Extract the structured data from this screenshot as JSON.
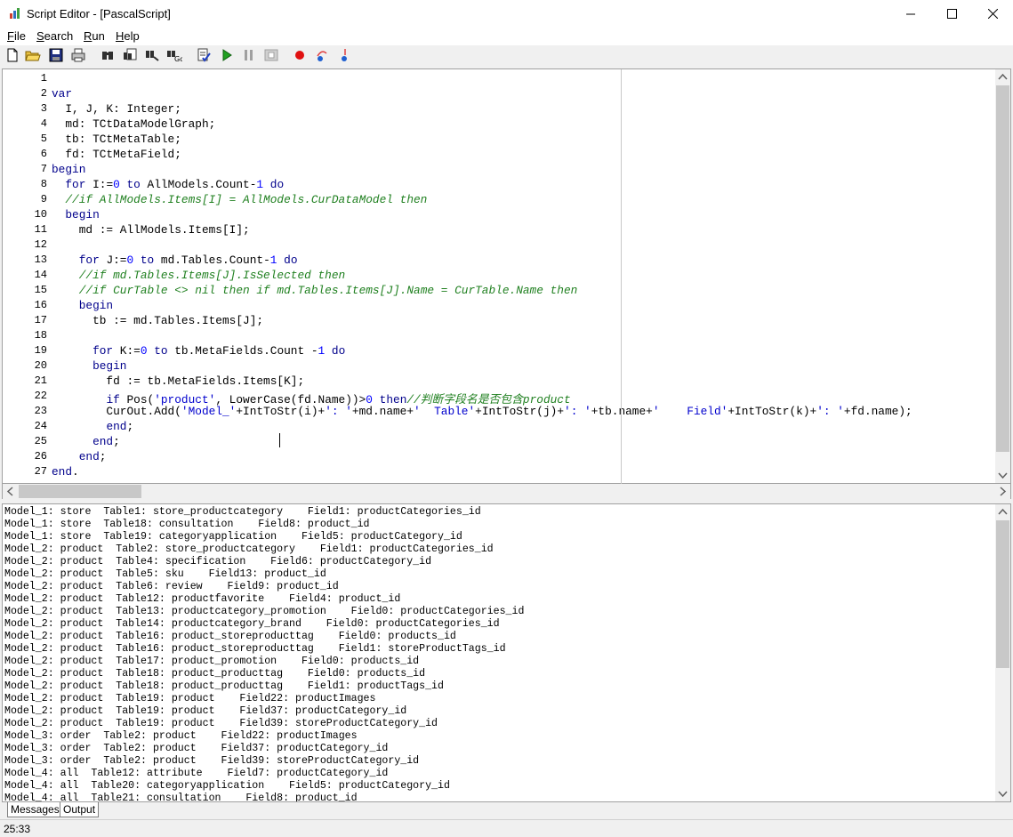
{
  "window": {
    "title": "Script Editor - [PascalScript]"
  },
  "menu": [
    {
      "label": "File",
      "accel": "F",
      "rest": "ile"
    },
    {
      "label": "Search",
      "accel": "S",
      "rest": "earch"
    },
    {
      "label": "Run",
      "accel": "R",
      "rest": "un"
    },
    {
      "label": "Help",
      "accel": "H",
      "rest": "elp"
    }
  ],
  "toolbar": [
    {
      "name": "new-file-icon"
    },
    {
      "name": "open-folder-icon"
    },
    {
      "name": "save-icon"
    },
    {
      "name": "print-icon"
    },
    {
      "name": "find-icon"
    },
    {
      "name": "find-next-icon"
    },
    {
      "name": "replace-icon"
    },
    {
      "name": "goto-line-icon"
    },
    {
      "name": "compile-icon"
    },
    {
      "name": "run-icon"
    },
    {
      "name": "pause-icon"
    },
    {
      "name": "stop-icon"
    },
    {
      "name": "breakpoint-icon"
    },
    {
      "name": "step-over-icon"
    },
    {
      "name": "step-into-icon"
    }
  ],
  "editor": {
    "lines": [
      {
        "n": "1",
        "t": ""
      },
      {
        "n": "2",
        "t": "<span class='kw'>var</span>"
      },
      {
        "n": "3",
        "t": "  I, J, K: Integer;"
      },
      {
        "n": "4",
        "t": "  md: TCtDataModelGraph;"
      },
      {
        "n": "5",
        "t": "  tb: TCtMetaTable;"
      },
      {
        "n": "6",
        "t": "  fd: TCtMetaField;"
      },
      {
        "n": "7",
        "t": "<span class='kw'>begin</span>"
      },
      {
        "n": "8",
        "t": "  <span class='kw'>for</span> I:=<span class='num'>0</span> <span class='kw'>to</span> AllModels.Count-<span class='num'>1</span> <span class='kw'>do</span>"
      },
      {
        "n": "9",
        "t": "  <span class='cm'>//if AllModels.Items[I] = AllModels.CurDataModel then</span>"
      },
      {
        "n": "10",
        "t": "  <span class='kw'>begin</span>"
      },
      {
        "n": "11",
        "t": "    md := AllModels.Items[I];"
      },
      {
        "n": "12",
        "t": ""
      },
      {
        "n": "13",
        "t": "    <span class='kw'>for</span> J:=<span class='num'>0</span> <span class='kw'>to</span> md.Tables.Count-<span class='num'>1</span> <span class='kw'>do</span>"
      },
      {
        "n": "14",
        "t": "    <span class='cm'>//if md.Tables.Items[J].IsSelected then</span>"
      },
      {
        "n": "15",
        "t": "    <span class='cm'>//if CurTable &lt;&gt; nil then if md.Tables.Items[J].Name = CurTable.Name then</span>"
      },
      {
        "n": "16",
        "t": "    <span class='kw'>begin</span>"
      },
      {
        "n": "17",
        "t": "      tb := md.Tables.Items[J];"
      },
      {
        "n": "18",
        "t": ""
      },
      {
        "n": "19",
        "t": "      <span class='kw'>for</span> K:=<span class='num'>0</span> <span class='kw'>to</span> tb.MetaFields.Count -<span class='num'>1</span> <span class='kw'>do</span>"
      },
      {
        "n": "20",
        "t": "      <span class='kw'>begin</span>"
      },
      {
        "n": "21",
        "t": "        fd := tb.MetaFields.Items[K];"
      },
      {
        "n": "22",
        "t": "        <span class='kw'>if</span> Pos(<span class='str'>'product'</span>, LowerCase(fd.Name))&gt;<span class='num'>0</span> <span class='kw'>then</span><span class='cm'>//判断字段名是否包含product</span>"
      },
      {
        "n": "23",
        "t": "        CurOut.Add(<span class='str'>'Model_'</span>+IntToStr(i)+<span class='str'>': '</span>+md.name+<span class='str'>'  Table'</span>+IntToStr(j)+<span class='str'>': '</span>+tb.name+<span class='str'>'    Field'</span>+IntToStr(k)+<span class='str'>': '</span>+fd.name);"
      },
      {
        "n": "24",
        "t": "        <span class='kw'>end</span>;"
      },
      {
        "n": "25",
        "t": "      <span class='kw'>end</span>;"
      },
      {
        "n": "26",
        "t": "    <span class='kw'>end</span>;"
      },
      {
        "n": "27",
        "t": "<span class='kw'>end</span>."
      }
    ]
  },
  "output": {
    "lines": [
      "Model_1: store  Table1: store_productcategory    Field1: productCategories_id",
      "Model_1: store  Table18: consultation    Field8: product_id",
      "Model_1: store  Table19: categoryapplication    Field5: productCategory_id",
      "Model_2: product  Table2: store_productcategory    Field1: productCategories_id",
      "Model_2: product  Table4: specification    Field6: productCategory_id",
      "Model_2: product  Table5: sku    Field13: product_id",
      "Model_2: product  Table6: review    Field9: product_id",
      "Model_2: product  Table12: productfavorite    Field4: product_id",
      "Model_2: product  Table13: productcategory_promotion    Field0: productCategories_id",
      "Model_2: product  Table14: productcategory_brand    Field0: productCategories_id",
      "Model_2: product  Table16: product_storeproducttag    Field0: products_id",
      "Model_2: product  Table16: product_storeproducttag    Field1: storeProductTags_id",
      "Model_2: product  Table17: product_promotion    Field0: products_id",
      "Model_2: product  Table18: product_producttag    Field0: products_id",
      "Model_2: product  Table18: product_producttag    Field1: productTags_id",
      "Model_2: product  Table19: product    Field22: productImages",
      "Model_2: product  Table19: product    Field37: productCategory_id",
      "Model_2: product  Table19: product    Field39: storeProductCategory_id",
      "Model_3: order  Table2: product    Field22: productImages",
      "Model_3: order  Table2: product    Field37: productCategory_id",
      "Model_3: order  Table2: product    Field39: storeProductCategory_id",
      "Model_4: all  Table12: attribute    Field7: productCategory_id",
      "Model_4: all  Table20: categoryapplication    Field5: productCategory_id",
      "Model_4: all  Table21: consultation    Field8: product_id"
    ]
  },
  "tabs": [
    {
      "label": "Messages"
    },
    {
      "label": "Output"
    }
  ],
  "status": {
    "position": "25:33"
  }
}
